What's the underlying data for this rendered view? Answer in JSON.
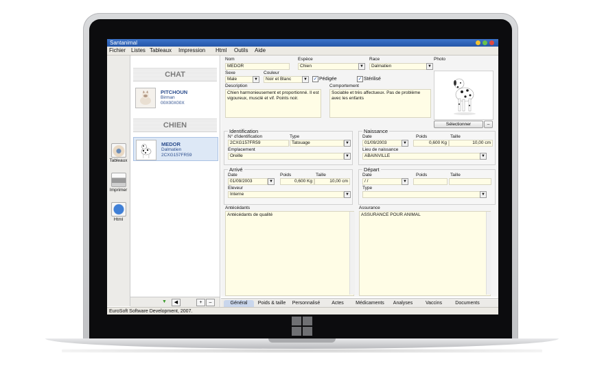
{
  "window": {
    "title": "Santanimal"
  },
  "menu": [
    "Fichier",
    "Listes",
    "Tableaux",
    "Impression",
    "Html",
    "Outils",
    "Aide"
  ],
  "toolbar": [
    {
      "label": "Tableaux",
      "icon": "eye-icon"
    },
    {
      "label": "Imprimer",
      "icon": "printer-icon"
    },
    {
      "label": "Html",
      "icon": "globe-icon"
    }
  ],
  "animals": {
    "groups": [
      {
        "title": "CHAT",
        "items": [
          {
            "name": "PITCHOUN",
            "breed": "Birman",
            "id": "00X00X00X"
          }
        ]
      },
      {
        "title": "CHIEN",
        "items": [
          {
            "name": "MEDOR",
            "breed": "Dalmatien",
            "id": "2CXG157FR59"
          }
        ]
      }
    ],
    "footer_icons": [
      "filter-icon",
      "prev-icon",
      "add-icon",
      "remove-icon"
    ]
  },
  "form": {
    "nom": {
      "label": "Nom",
      "value": "MEDOR"
    },
    "espece": {
      "label": "Espèce",
      "value": "Chien"
    },
    "race": {
      "label": "Race",
      "value": "Dalmatien"
    },
    "photo": {
      "label": "Photo",
      "button": "Sélectionner",
      "button_minus": "–"
    },
    "sexe": {
      "label": "Sexe",
      "value": "Male"
    },
    "couleur": {
      "label": "Couleur",
      "value": "Noir et Blanc"
    },
    "pedigree": {
      "label": "Pédigée",
      "checked": true
    },
    "sterilise": {
      "label": "Stérilisé",
      "checked": true
    },
    "description": {
      "label": "Description",
      "value": "Chien harmonieusement et proportionné.  Il est vigoureux, musclé et vif. Points noir."
    },
    "comportement": {
      "label": "Comportement",
      "value": "Sociable et très affectueux. Pas de problème avec les enfants"
    },
    "identification": {
      "title": "Identification",
      "num_label": "N° d'identification",
      "num_value": "2CXG157FR59",
      "type_label": "Type",
      "type_value": "Tatouage",
      "emplacement_label": "Emplacement",
      "emplacement_value": "Oreille"
    },
    "naissance": {
      "title": "Naissance",
      "date_label": "Date",
      "date_value": "01/09/2003",
      "poids_label": "Poids",
      "poids_value": "0,600 Kg",
      "taille_label": "Taille",
      "taille_value": "10,00 cm",
      "lieu_label": "Lieu de naissance",
      "lieu_value": "ABAINVILLE"
    },
    "arrive": {
      "title": "Arrivé",
      "date_label": "Date",
      "date_value": "01/09/2003",
      "poids_label": "Poids",
      "poids_value": "0,600 Kg",
      "taille_label": "Taille",
      "taille_value": "10,00 cm",
      "eleveur_label": "Eleveur",
      "eleveur_value": "Interne"
    },
    "depart": {
      "title": "Départ",
      "date_label": "Date",
      "date_value": " / /",
      "poids_label": "Poids",
      "poids_value": "",
      "taille_label": "Taille",
      "taille_value": "",
      "type_label": "Type",
      "type_value": ""
    },
    "antecedants": {
      "label": "Antécédants",
      "value": "Antécédants de qualité"
    },
    "assurance": {
      "label": "Assurance",
      "value": "ASSURANCE POUR ANIMAL"
    }
  },
  "tabs": [
    "Général",
    "Poids & taille",
    "Personnalisé",
    "Actes",
    "Médicaments",
    "Analyses",
    "Vaccins",
    "Documents"
  ],
  "active_tab": "Général",
  "status": "EuroSoft Software Development, 2007.",
  "colors": {
    "title_bar": "#2456a8",
    "field_bg": "#fffde6",
    "tab_active": "#c9d6ec"
  }
}
